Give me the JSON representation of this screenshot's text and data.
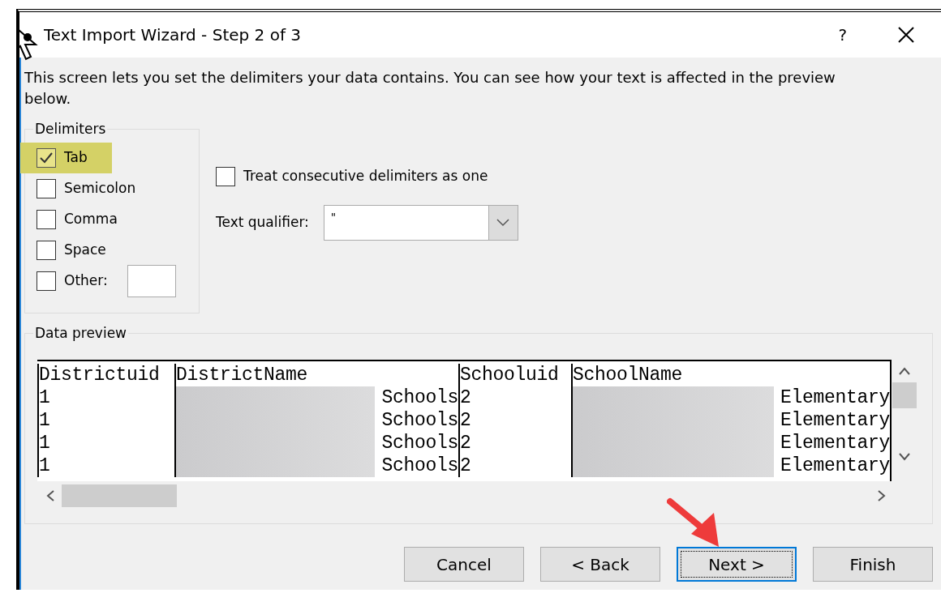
{
  "window": {
    "title": "Text Import Wizard - Step 2 of 3",
    "help": "?"
  },
  "description": "This screen lets you set the delimiters your data contains.  You can see how your text is affected in the preview below.",
  "delimiters": {
    "title": "Delimiters",
    "options": [
      {
        "label": "Tab",
        "checked": true,
        "highlighted": true,
        "kind": "plain"
      },
      {
        "label": "Semicolon",
        "checked": false,
        "highlighted": false,
        "kind": "plain"
      },
      {
        "label": "Comma",
        "checked": false,
        "highlighted": false,
        "kind": "plain"
      },
      {
        "label": "Space",
        "checked": false,
        "highlighted": false,
        "kind": "plain"
      },
      {
        "label": "Other:",
        "checked": false,
        "highlighted": false,
        "kind": "with_field"
      }
    ]
  },
  "treat_consecutive": {
    "label": "Treat consecutive delimiters as one",
    "checked": false
  },
  "text_qualifier": {
    "label": "Text qualifier:",
    "value": "\""
  },
  "data_preview": {
    "title": "Data preview",
    "columns": [
      "Districtuid",
      "DistrictName",
      "Schooluid",
      "SchoolName"
    ],
    "rows": [
      [
        {
          "text": "1",
          "redacted": false
        },
        {
          "text": "Schools",
          "redacted": true
        },
        {
          "text": "2",
          "redacted": false
        },
        {
          "text": "Elementary",
          "redacted": true
        }
      ],
      [
        {
          "text": "1",
          "redacted": false
        },
        {
          "text": "Schools",
          "redacted": true
        },
        {
          "text": "2",
          "redacted": false
        },
        {
          "text": "Elementary",
          "redacted": true
        }
      ],
      [
        {
          "text": "1",
          "redacted": false
        },
        {
          "text": "Schools",
          "redacted": true
        },
        {
          "text": "2",
          "redacted": false
        },
        {
          "text": "Elementary",
          "redacted": true
        }
      ],
      [
        {
          "text": "1",
          "redacted": false
        },
        {
          "text": "Schools",
          "redacted": true
        },
        {
          "text": "2",
          "redacted": false
        },
        {
          "text": "Elementary",
          "redacted": true
        }
      ]
    ]
  },
  "buttons": [
    {
      "label": "Cancel",
      "default": false,
      "pointed": false
    },
    {
      "label": "< Back",
      "default": false,
      "pointed": false
    },
    {
      "label": "Next >",
      "default": true,
      "pointed": true
    },
    {
      "label": "Finish",
      "default": false,
      "pointed": false
    }
  ]
}
